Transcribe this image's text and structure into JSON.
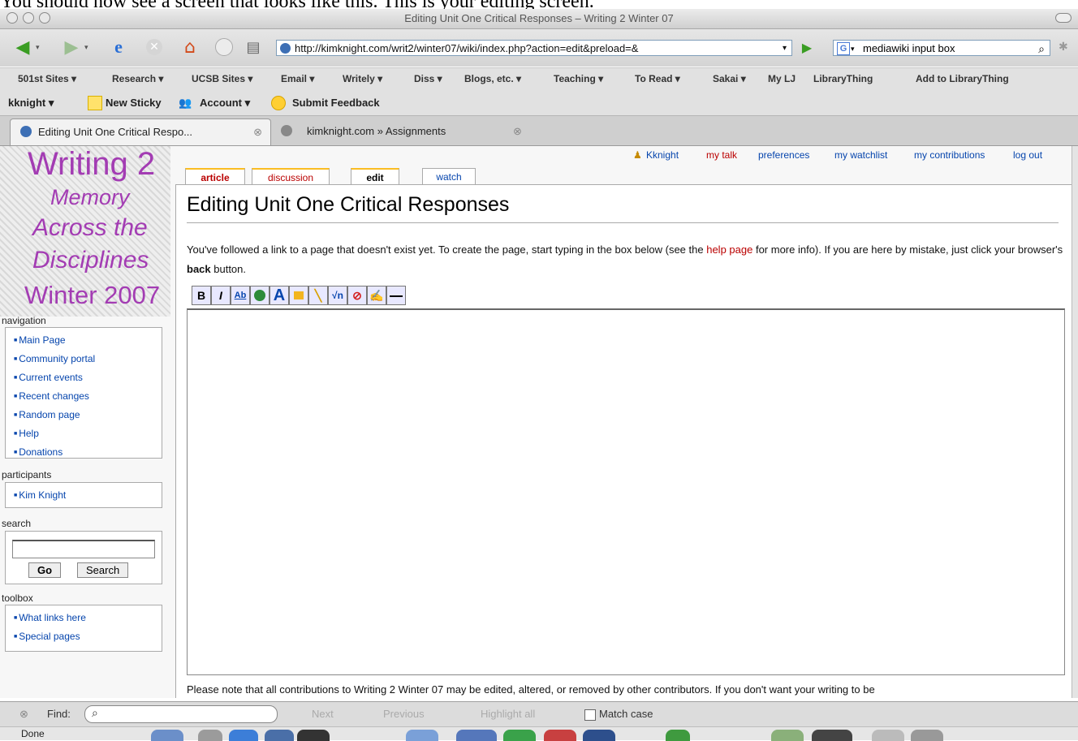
{
  "caption": "You should now see a screen that looks like this.  This is your editing screen.",
  "window": {
    "title": "Editing Unit One Critical Responses – Writing 2 Winter 07"
  },
  "toolbar": {
    "url": "http://kimknight.com/writ2/winter07/wiki/index.php?action=edit&preload=&",
    "search_value": "mediawiki input box"
  },
  "bookmarks": [
    "501st Sites ▾",
    "Research ▾",
    "UCSB Sites ▾",
    "Email ▾",
    "Writely ▾",
    "Diss ▾",
    "Blogs, etc. ▾",
    "Teaching ▾",
    "To Read ▾",
    "Sakai ▾",
    "My LJ",
    "LibraryThing",
    "Add to LibraryThing"
  ],
  "extension_bar": {
    "user": "kknight ▾",
    "sticky": "New Sticky",
    "account": "Account ▾",
    "feedback": "Submit Feedback"
  },
  "tabs": [
    "Editing Unit One Critical Respo...",
    "kimknight.com » Assignments"
  ],
  "logo": {
    "line1": "Writing 2",
    "line2": "Memory",
    "line3": "Across the",
    "line4": "Disciplines",
    "line5": "Winter 2007"
  },
  "sidebar": {
    "navigation_title": "navigation",
    "navigation": [
      "Main Page",
      "Community portal",
      "Current events",
      "Recent changes",
      "Random page",
      "Help",
      "Donations"
    ],
    "participants_title": "participants",
    "participants": [
      "Kim Knight"
    ],
    "search_title": "search",
    "go": "Go",
    "search": "Search",
    "toolbox_title": "toolbox",
    "toolbox": [
      "What links here",
      "Special pages"
    ]
  },
  "personal_tools": {
    "user": "Kknight",
    "talk": "my talk",
    "preferences": "preferences",
    "watchlist": "my watchlist",
    "contributions": "my contributions",
    "logout": "log out"
  },
  "content_tabs": {
    "article": "article",
    "discussion": "discussion",
    "edit": "edit",
    "watch": "watch"
  },
  "page": {
    "heading": "Editing Unit One Critical Responses",
    "intro_pre": "You've followed a link to a page that doesn't exist yet. To create the page, start typing in the box below (see the ",
    "intro_link": "help page",
    "intro_mid": " for more info). If you are here by mistake, just click your browser's ",
    "intro_bold": "back",
    "intro_post": " button.",
    "editor_value": "",
    "note": "Please note that all contributions to Writing 2 Winter 07 may be edited, altered, or removed by other contributors. If you don't want your writing to be"
  },
  "editor_toolbar": {
    "bold": "B",
    "italic": "I",
    "link": "Ab"
  },
  "findbar": {
    "label": "Find:",
    "next": "Next",
    "previous": "Previous",
    "highlight": "Highlight all",
    "match_case": "Match case"
  },
  "status": {
    "text": "Done"
  }
}
